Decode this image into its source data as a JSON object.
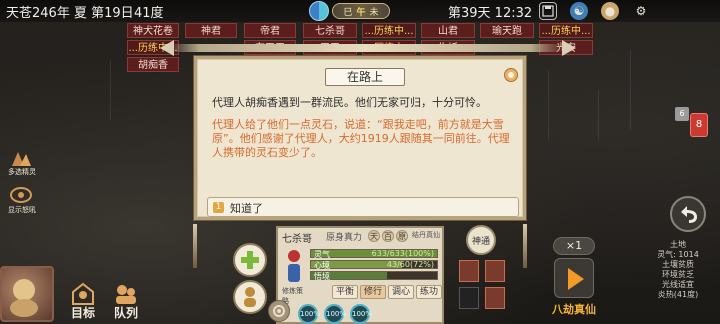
{
  "top_bar": {
    "date": "天苍246年 夏 第19日",
    "temperature": "41度",
    "time_of_day": [
      "巳",
      "午",
      "未"
    ],
    "active_time": "午",
    "day_and_clock": "第39天 12:32",
    "icons": [
      "save-icon",
      "yin-yang-icon",
      "palette-icon",
      "settings-icon"
    ]
  },
  "name_tags": {
    "row1": [
      "神犬花卷",
      "神君",
      "帝君",
      "七杀哥",
      "...历练中...",
      "山君",
      "瑜天跑",
      "...历练中..."
    ],
    "row2": [
      "...历练中...",
      "东天王",
      "天王",
      "历练中",
      "牛妖",
      "光安"
    ],
    "row3": [
      "胡痴香"
    ]
  },
  "dialog": {
    "title": "在路上",
    "narration": "代理人胡痴香遇到一群流民。他们无家可归，十分可怜。",
    "event_text": "代理人给了他们一点灵石，说道：“跟我走吧，前方就是大雪原”。他们感谢了代理人，大约1919人跟随其一同前往。代理人携带的灵石变少了。",
    "option_number": "1",
    "option_label": "知道了"
  },
  "panel": {
    "name": "七杀哥",
    "header_label": "原身真力",
    "header_chips": [
      "天",
      "百",
      "原"
    ],
    "header_right": "结丹真仙",
    "bars": [
      {
        "label": "灵气",
        "value": "633/633(100%)",
        "fraction": 1.0,
        "color": "#6c8f3a"
      },
      {
        "label": "心境",
        "value": "43/60(72%)",
        "fraction": 0.72,
        "color": "#7c9b46"
      },
      {
        "label": "悟境",
        "value": "",
        "fraction": 0.6,
        "color": "#5b7d3b"
      }
    ],
    "mode_label": "修炼策略",
    "buttons": [
      "平衡",
      "修行",
      "调心",
      "练功"
    ],
    "active_button": "修行",
    "percents": [
      "100%",
      "100%",
      "100%"
    ]
  },
  "left_side": {
    "labels": [
      "多选精灵",
      "显示怒吼"
    ],
    "bottom": [
      "目标",
      "队列"
    ]
  },
  "right_side": {
    "transfer_label": "神通",
    "speed": "×1",
    "event_label": "八劫真仙",
    "notification_count": "8",
    "grey_badge": "6",
    "stats": [
      "土地",
      "灵气: 1014",
      "土壤贫质",
      "环境贫乏",
      "光线适宜",
      "炎热(41度)"
    ]
  }
}
